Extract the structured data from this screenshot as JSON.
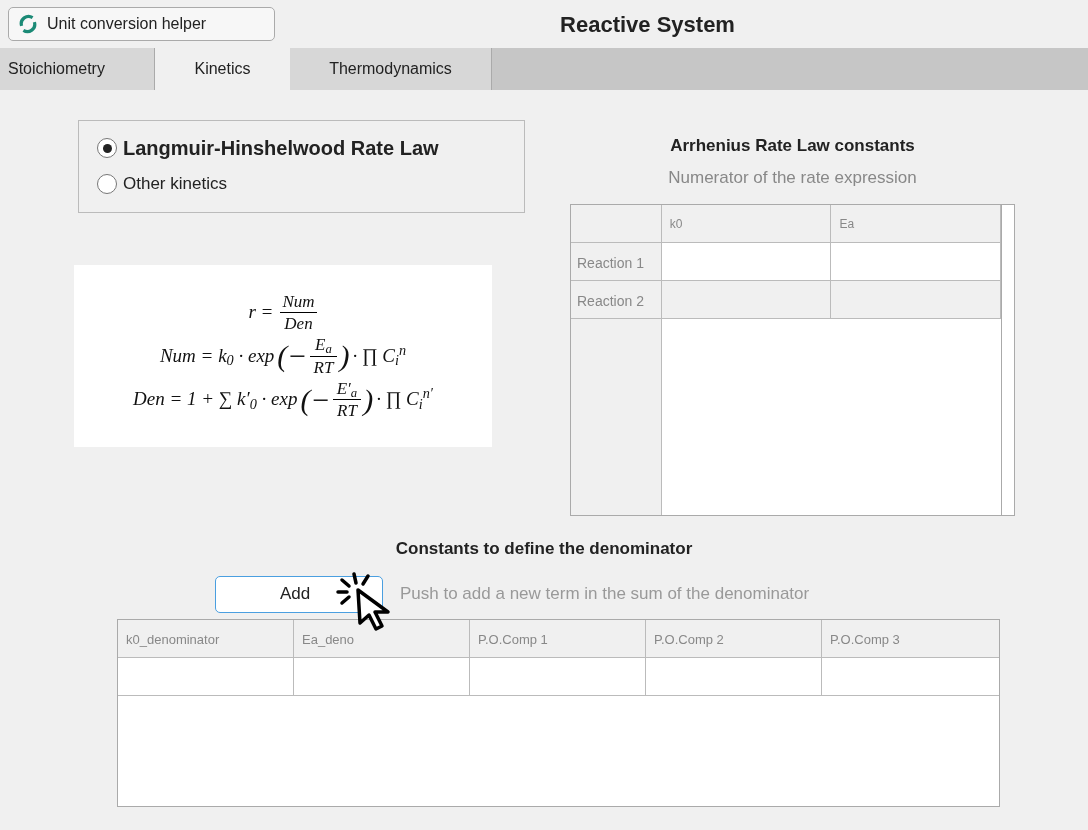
{
  "header": {
    "helper_button": "Unit conversion helper",
    "title": "Reactive System"
  },
  "tabs": [
    {
      "label": "Stoichiometry",
      "selected": false
    },
    {
      "label": "Kinetics",
      "selected": true
    },
    {
      "label": "Thermodynamics",
      "selected": false
    }
  ],
  "rate_law_options": [
    {
      "label": "Langmuir-Hinshelwood Rate Law",
      "selected": true
    },
    {
      "label": "Other kinetics",
      "selected": false
    }
  ],
  "formula": [
    [
      {
        "kind": "text",
        "text": "r ="
      },
      {
        "kind": "fraction",
        "num": "Num",
        "den": "Den"
      }
    ],
    [
      {
        "kind": "text",
        "text": "Num = k$_{0}$ · exp"
      },
      {
        "kind": "paren",
        "text": "(−"
      },
      {
        "kind": "fraction",
        "num": "E$_{a}$",
        "den": "RT"
      },
      {
        "kind": "paren",
        "text": ")"
      },
      {
        "kind": "text",
        "text": "· ∏ C$_{i}$$^{n}$"
      }
    ],
    [
      {
        "kind": "text",
        "text": "Den = 1 + ∑ k′$_{0}$ · exp"
      },
      {
        "kind": "paren",
        "text": "(−"
      },
      {
        "kind": "fraction",
        "num": "E′$_{a}$",
        "den": "RT"
      },
      {
        "kind": "paren",
        "text": ")"
      },
      {
        "kind": "text",
        "text": "· ∏ C$_{i}$$^{n′}$"
      }
    ]
  ],
  "arrhenius": {
    "title": "Arrhenius Rate Law constants",
    "subtitle": "Numerator of the rate expression",
    "columns": [
      "k0",
      "Ea"
    ],
    "rows": [
      {
        "label": "Reaction 1"
      },
      {
        "label": "Reaction 2"
      }
    ]
  },
  "denominator": {
    "title": "Constants to define the denominator",
    "add_button": "Add",
    "hint": "Push to add a new term in the sum of the denominator",
    "columns": [
      "k0_denominator",
      "Ea_deno",
      "P.O.Comp 1",
      "P.O.Comp 2",
      "P.O.Comp 3"
    ]
  }
}
